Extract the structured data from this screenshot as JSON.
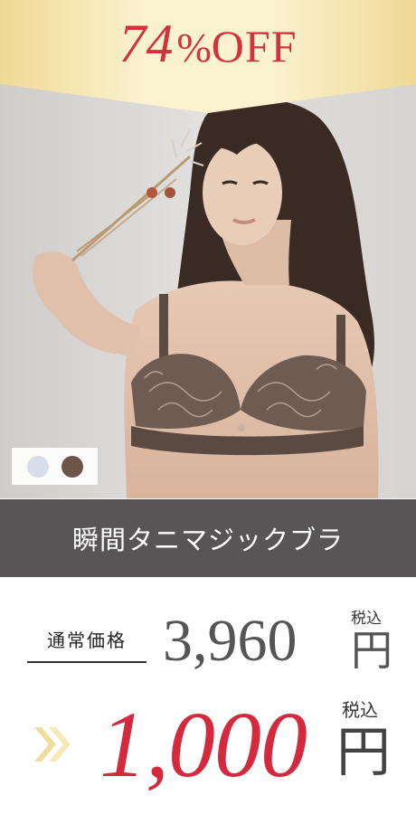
{
  "banner": {
    "number": "74",
    "percent": "%",
    "off": "OFF"
  },
  "photo": {
    "description_icon": "model-photo-image"
  },
  "swatches": {
    "colors": [
      "#d6dee9",
      "#6b5546"
    ]
  },
  "product": {
    "name": "瞬間タニマジックブラ"
  },
  "pricing": {
    "regular_label": "通常価格",
    "regular_price": "3,960",
    "regular_currency": "円",
    "tax_label_1": "税込",
    "sale_price": "1,000",
    "sale_currency": "円",
    "tax_label_2": "税込",
    "arrow_icon": "double-chevron-right-icon"
  },
  "colors": {
    "banner_text": "#d2323c",
    "sale_price": "#d52a3e",
    "name_bar": "#595556",
    "gold_light": "#fbf2cf",
    "gold_dark": "#efd995"
  }
}
